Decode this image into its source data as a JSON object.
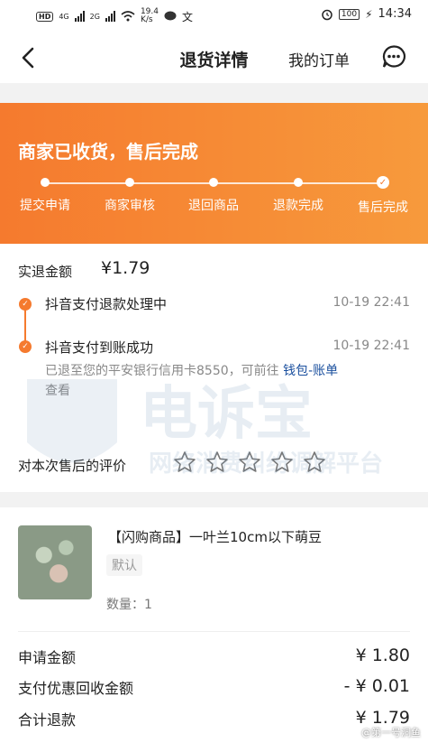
{
  "status_bar": {
    "network": "HD",
    "signal1": "4G",
    "signal2": "2G",
    "speed_value": "19.4",
    "speed_unit": "K/s",
    "battery": "100",
    "time": "14:34"
  },
  "navbar": {
    "title": "退货详情",
    "my_orders": "我的订单"
  },
  "hero": {
    "title": "商家已收货，售后完成",
    "steps": [
      "提交申请",
      "商家审核",
      "退回商品",
      "退款完成",
      "售后完成"
    ]
  },
  "refund": {
    "label": "实退金额",
    "amount": "¥1.79",
    "timeline": [
      {
        "text": "抖音支付退款处理中",
        "time": "10-19 22:41"
      },
      {
        "text": "抖音支付到账成功",
        "time": "10-19 22:41"
      }
    ],
    "desc_prefix": "已退至您的平安银行信用卡8550，可前往 ",
    "desc_link": "钱包-账单",
    "desc_suffix": "查看"
  },
  "rating": {
    "label": "对本次售后的评价",
    "stars_filled": 0,
    "stars_total": 5
  },
  "watermark": {
    "main": "电诉宝",
    "sub": "网络消费纠纷调解平台"
  },
  "product": {
    "title": "【闪购商品】一叶兰10cm以下萌豆",
    "spec": "默认",
    "quantity": "数量：1"
  },
  "summary": [
    {
      "label": "申请金额",
      "value": "¥ 1.80"
    },
    {
      "label": "支付优惠回收金额",
      "value": "- ¥ 0.01"
    },
    {
      "label": "合计退款",
      "value": "¥ 1.79"
    }
  ],
  "corner_watermark": "@第一号洞鱼",
  "colors": {
    "accent": "#f57a2e",
    "link": "#1a4f9e"
  }
}
